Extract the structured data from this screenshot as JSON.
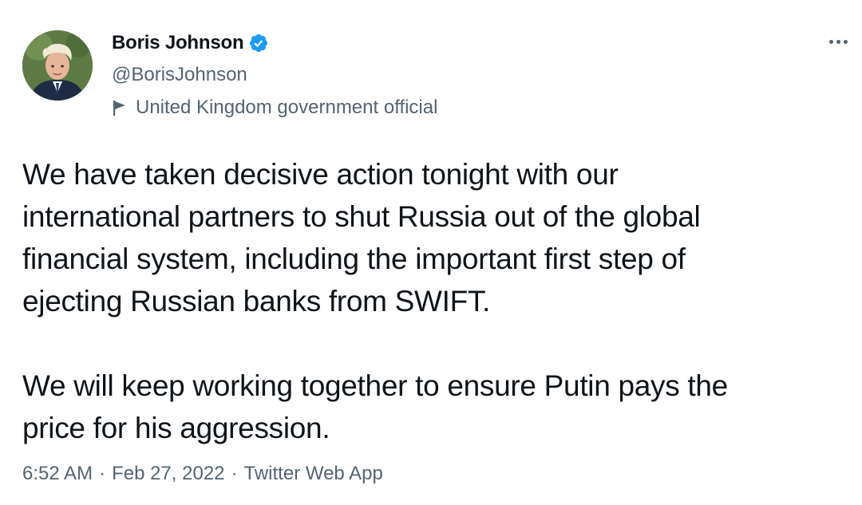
{
  "tweet": {
    "author": {
      "name": "Boris Johnson",
      "handle": "@BorisJohnson",
      "verified": true,
      "label": "United Kingdom government official"
    },
    "text_lines_p1": [
      "We have taken decisive action tonight with our",
      "international partners to shut Russia out of the global",
      "financial system, including the important first step of",
      "ejecting Russian banks from SWIFT."
    ],
    "text_lines_p2": [
      "We will keep working together to ensure Putin pays the",
      "price for his aggression."
    ],
    "meta": {
      "time": "6:52 AM",
      "separator": "·",
      "date": "Feb 27, 2022",
      "source": "Twitter Web App"
    }
  },
  "icons": {
    "verified": "verified-badge-icon",
    "flag": "flag-icon",
    "more": "more-options-icon"
  },
  "colors": {
    "text": "#0f1419",
    "secondary": "#536471",
    "verified": "#1d9bf0",
    "background": "#ffffff"
  }
}
